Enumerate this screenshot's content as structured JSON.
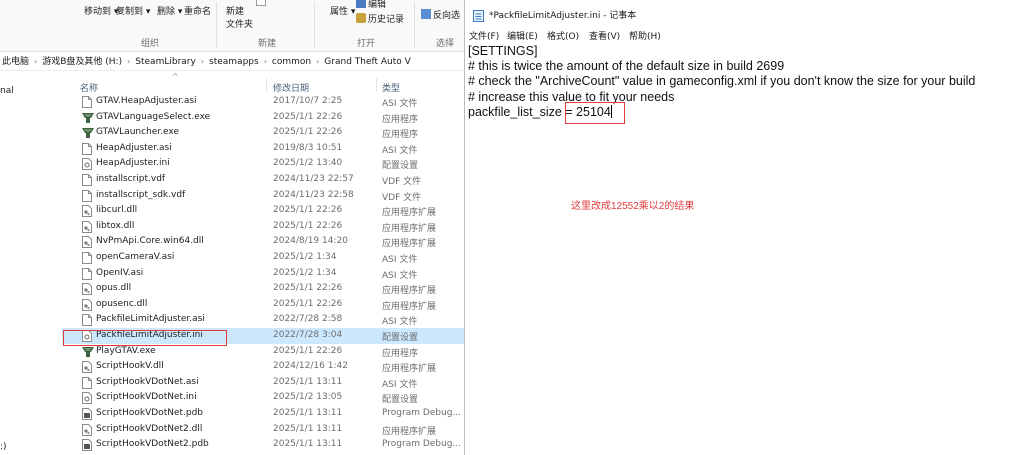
{
  "explorer": {
    "ribbon": {
      "copy_to": "移动到",
      "copy_btn": "复制到",
      "delete": "删除",
      "rename": "重命名",
      "new_folder_line1": "新建",
      "new_folder_line2": "文件夹",
      "properties": "属性",
      "edit": "编辑",
      "history": "历史记录",
      "invert_select": "反向选",
      "group_organize": "组织",
      "group_new": "新建",
      "group_open": "打开",
      "group_select": "选择"
    },
    "address": {
      "crumbs": [
        "此电脑",
        "游戏B盘及其他 (H:)",
        "SteamLibrary",
        "steamapps",
        "common",
        "Grand Theft Auto V"
      ]
    },
    "nav": {
      "item1": "nal",
      "item2": ":)"
    },
    "columns": {
      "name": "名称",
      "modified": "修改日期",
      "type": "类型"
    },
    "files": [
      {
        "name": "GTAV.HeapAdjuster.asi",
        "date": "2017/10/7 2:25",
        "type": "ASI 文件",
        "icon": "file-icon"
      },
      {
        "name": "GTAVLanguageSelect.exe",
        "date": "2025/1/1 22:26",
        "type": "应用程序",
        "icon": "gtav-app-icon"
      },
      {
        "name": "GTAVLauncher.exe",
        "date": "2025/1/1 22:26",
        "type": "应用程序",
        "icon": "gtav-app-icon"
      },
      {
        "name": "HeapAdjuster.asi",
        "date": "2019/8/3 10:51",
        "type": "ASI 文件",
        "icon": "file-icon"
      },
      {
        "name": "HeapAdjuster.ini",
        "date": "2025/1/2 13:40",
        "type": "配置设置",
        "icon": "ini-icon"
      },
      {
        "name": "installscript.vdf",
        "date": "2024/11/23 22:57",
        "type": "VDF 文件",
        "icon": "file-icon"
      },
      {
        "name": "installscript_sdk.vdf",
        "date": "2024/11/23 22:58",
        "type": "VDF 文件",
        "icon": "file-icon"
      },
      {
        "name": "libcurl.dll",
        "date": "2025/1/1 22:26",
        "type": "应用程序扩展",
        "icon": "dll-icon"
      },
      {
        "name": "libtox.dll",
        "date": "2025/1/1 22:26",
        "type": "应用程序扩展",
        "icon": "dll-icon"
      },
      {
        "name": "NvPmApi.Core.win64.dll",
        "date": "2024/8/19 14:20",
        "type": "应用程序扩展",
        "icon": "dll-icon"
      },
      {
        "name": "openCameraV.asi",
        "date": "2025/1/2 1:34",
        "type": "ASI 文件",
        "icon": "file-icon"
      },
      {
        "name": "OpenIV.asi",
        "date": "2025/1/2 1:34",
        "type": "ASI 文件",
        "icon": "file-icon"
      },
      {
        "name": "opus.dll",
        "date": "2025/1/1 22:26",
        "type": "应用程序扩展",
        "icon": "dll-icon"
      },
      {
        "name": "opusenc.dll",
        "date": "2025/1/1 22:26",
        "type": "应用程序扩展",
        "icon": "dll-icon"
      },
      {
        "name": "PackfileLimitAdjuster.asi",
        "date": "2022/7/28 2:58",
        "type": "ASI 文件",
        "icon": "file-icon"
      },
      {
        "name": "PackfileLimitAdjuster.ini",
        "date": "2022/7/28 3:04",
        "type": "配置设置",
        "icon": "ini-icon",
        "selected": true
      },
      {
        "name": "PlayGTAV.exe",
        "date": "2025/1/1 22:26",
        "type": "应用程序",
        "icon": "gtav-app-icon"
      },
      {
        "name": "ScriptHookV.dll",
        "date": "2024/12/16 1:42",
        "type": "应用程序扩展",
        "icon": "dll-icon"
      },
      {
        "name": "ScriptHookVDotNet.asi",
        "date": "2025/1/1 13:11",
        "type": "ASI 文件",
        "icon": "file-icon"
      },
      {
        "name": "ScriptHookVDotNet.ini",
        "date": "2025/1/2 13:05",
        "type": "配置设置",
        "icon": "ini-icon"
      },
      {
        "name": "ScriptHookVDotNet.pdb",
        "date": "2025/1/1 13:11",
        "type": "Program Debug...",
        "icon": "pdb-icon"
      },
      {
        "name": "ScriptHookVDotNet2.dll",
        "date": "2025/1/1 13:11",
        "type": "应用程序扩展",
        "icon": "dll-icon"
      },
      {
        "name": "ScriptHookVDotNet2.pdb",
        "date": "2025/1/1 13:11",
        "type": "Program Debug...",
        "icon": "pdb-icon"
      }
    ]
  },
  "notepad": {
    "title": "*PackfileLimitAdjuster.ini - 记事本",
    "menu": {
      "file": "文件(F)",
      "edit": "编辑(E)",
      "format": "格式(O)",
      "view": "查看(V)",
      "help": "帮助(H)"
    },
    "lines": [
      "[SETTINGS]",
      "# this is twice the amount of the default size in build 2699",
      "# check the \"ArchiveCount\" value in gameconfig.xml if you don't know the size for your build",
      "# increase this value to fit your needs"
    ],
    "last_line_key": "packfile_list_size = ",
    "last_line_value": "25104",
    "annotation": "这里改成12552乘以2的结果"
  },
  "colors": {
    "highlight_red": "#e23b3b",
    "selection_blue": "#cce8ff"
  }
}
